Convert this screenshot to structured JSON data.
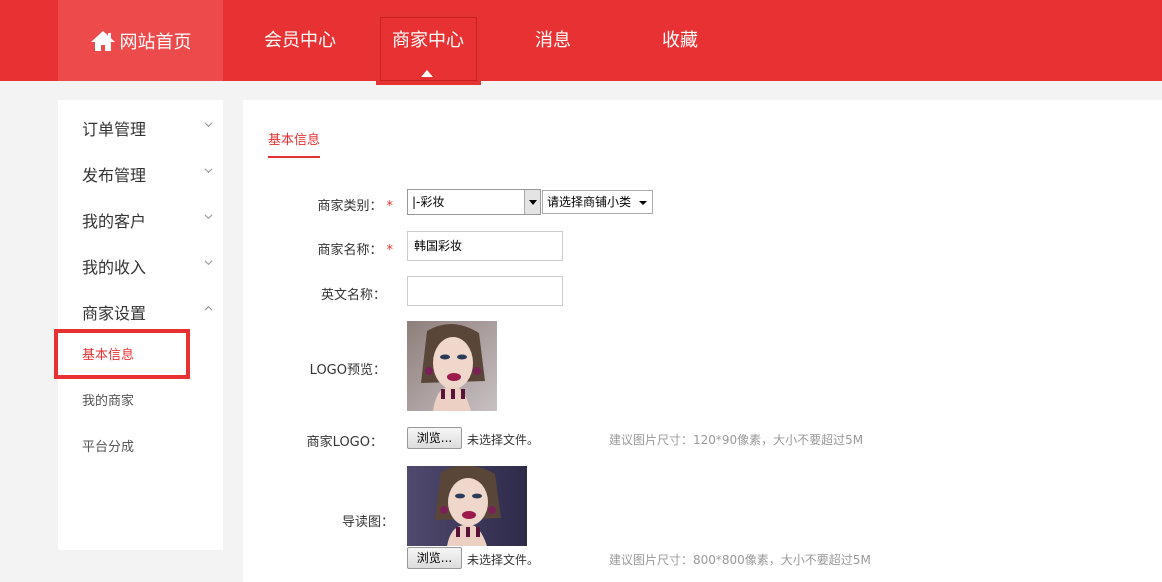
{
  "nav": {
    "home": "网站首页",
    "items": [
      "会员中心",
      "商家中心",
      "消息",
      "收藏"
    ]
  },
  "sidebar": {
    "groups": [
      "订单管理",
      "发布管理",
      "我的客户",
      "我的收入",
      "商家设置"
    ],
    "sub": [
      "基本信息",
      "我的商家",
      "平台分成"
    ]
  },
  "main": {
    "tab": "基本信息",
    "labels": {
      "category": "商家类别：",
      "name": "商家名称：",
      "en_name": "英文名称：",
      "logo_preview": "LOGO预览：",
      "logo": "商家LOGO：",
      "guide": "导读图："
    },
    "required_mark": "*",
    "category_value": "|-彩妆",
    "subcategory_value": "请选择商铺小类",
    "name_value": "韩国彩妆",
    "en_name_value": "",
    "browse_label": "浏览...",
    "no_file": "未选择文件。",
    "logo_hint": "建议图片尺寸：120*90像素，大小不要超过5M",
    "guide_hint": "建议图片尺寸：800*800像素，大小不要超过5M"
  },
  "colors": {
    "brand": "#e83132",
    "nav_home_bg": "#ec4a4b"
  }
}
